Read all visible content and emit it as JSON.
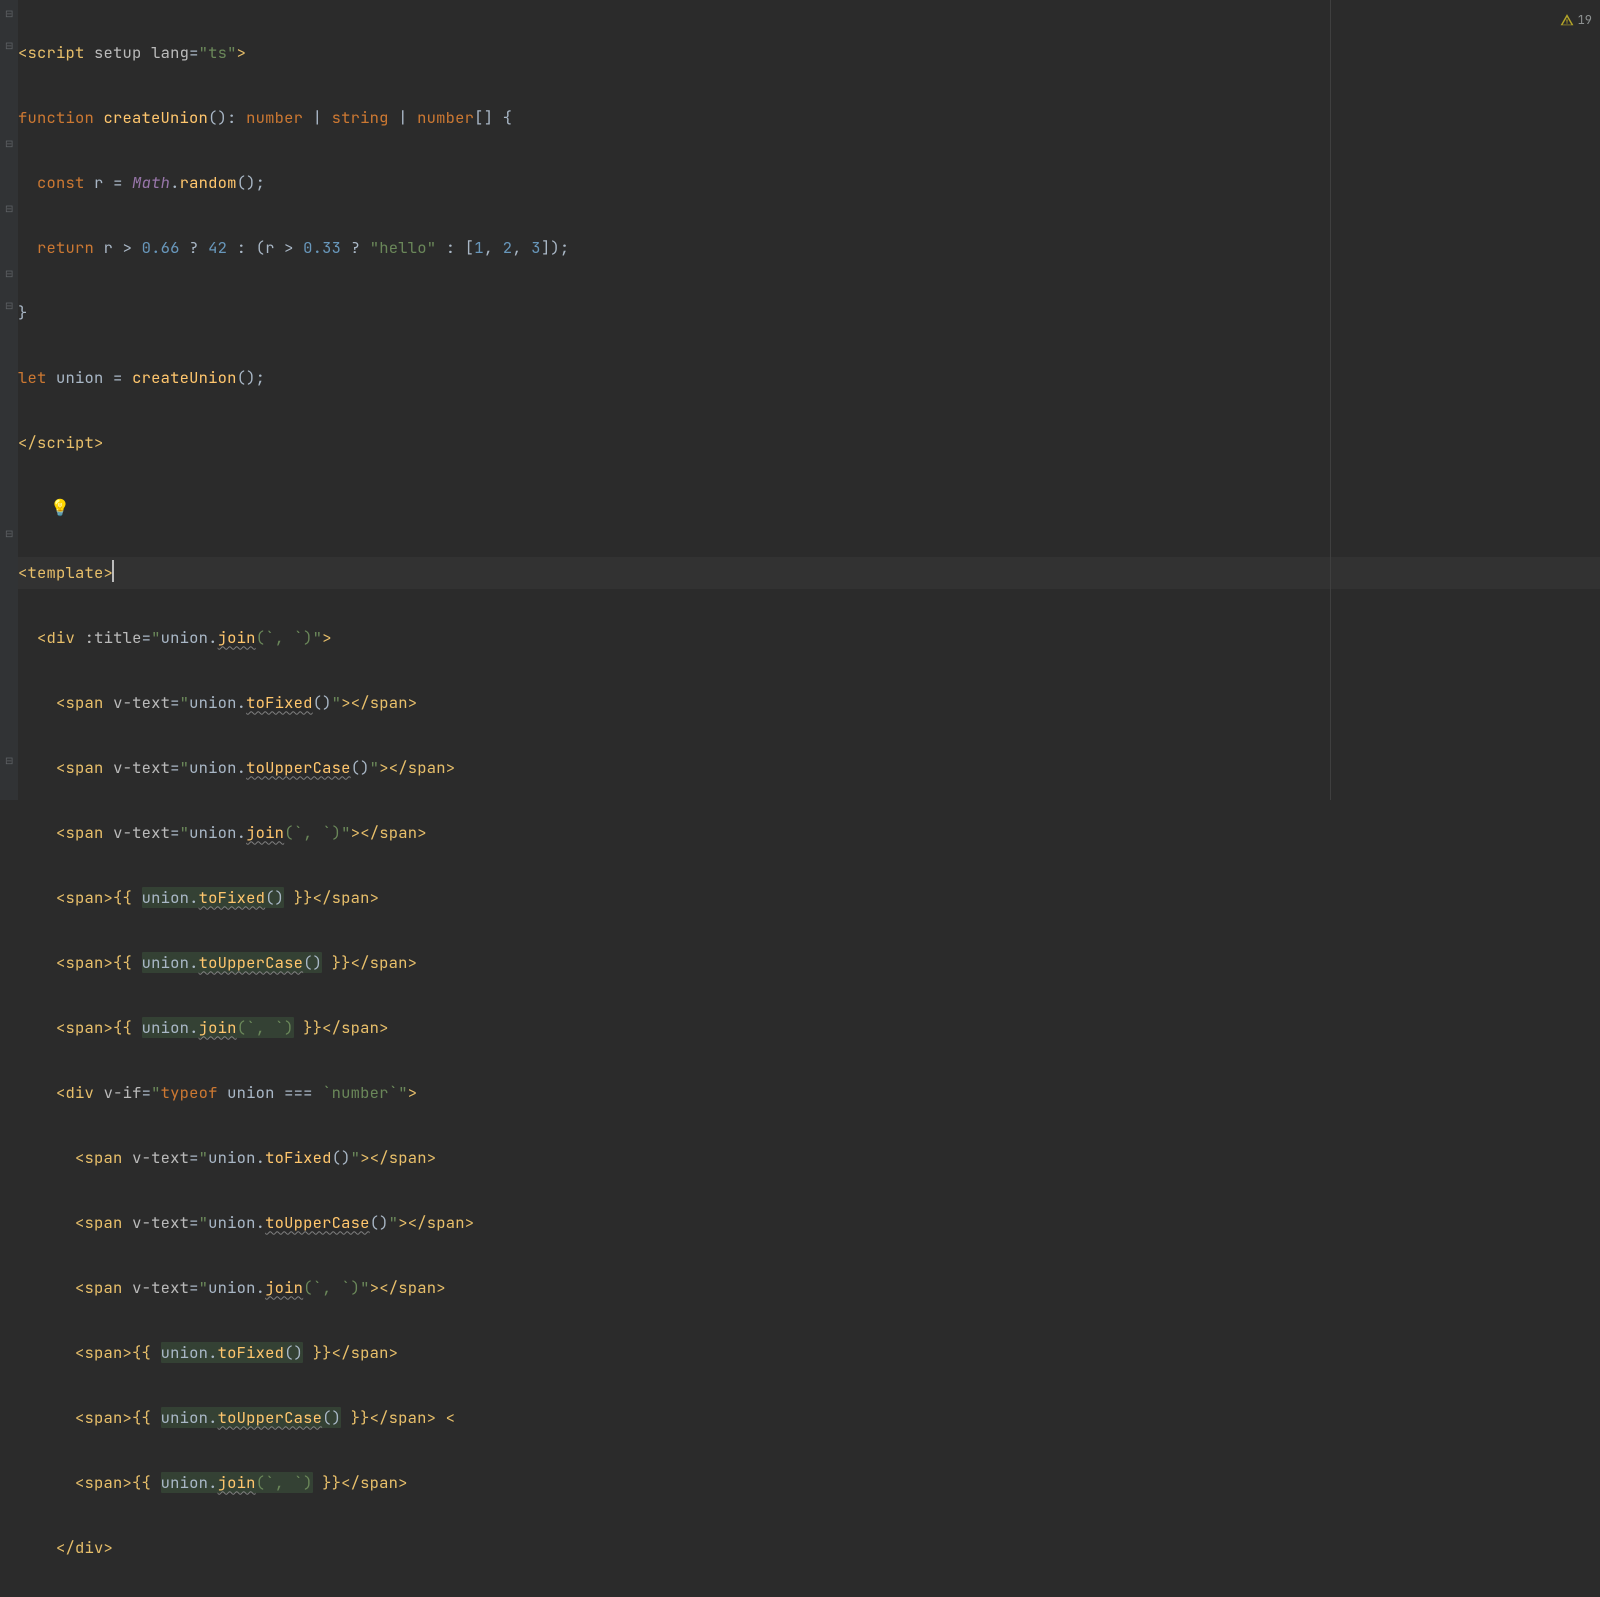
{
  "warnings_count": "19",
  "code": {
    "l1": {
      "pre": "<",
      "tag1": "script",
      "sp": " ",
      "a1": "setup",
      "sp2": " ",
      "a2": "lang",
      "eq": "=",
      "v": "\"ts\"",
      "post": ">"
    },
    "l2": {
      "kw1": "function",
      "sp": " ",
      "fn": "createUnion",
      "paren": "(): ",
      "t1": "number",
      "bar1": " | ",
      "t2": "string",
      "bar2": " | ",
      "t3": "number",
      "arr": "[] {"
    },
    "l3": {
      "indent": "  ",
      "kw": "const",
      "sp": " ",
      "id": "r",
      "eq": " = ",
      "cls": "Math",
      "dot": ".",
      "m": "random",
      "rest": "();"
    },
    "l4": {
      "indent": "  ",
      "kw": "return",
      "sp": " ",
      "id": "r",
      "op1": " > ",
      "n1": "0.66",
      "q": " ? ",
      "n2": "42",
      "c": " : (",
      "id2": "r",
      "op2": " > ",
      "n3": "0.33",
      "q2": " ? ",
      "s": "\"hello\"",
      "c2": " : [",
      "a1": "1",
      "cm1": ", ",
      "a2": "2",
      "cm2": ", ",
      "a3": "3",
      "end": "]);"
    },
    "l5": {
      "brace": "}"
    },
    "l6": {
      "kw": "let",
      "sp": " ",
      "id": "union",
      "eq": " = ",
      "fn": "createUnion",
      "rest": "();"
    },
    "l7": {
      "pre": "</",
      "tag": "script",
      "post": ">"
    },
    "l9": {
      "pre": "<",
      "tag": "template",
      "post": ">"
    },
    "l10": {
      "indent": "  ",
      "pre": "<",
      "tag": "div",
      "sp": " ",
      "attr": ":title",
      "eq": "=",
      "q": "\"",
      "id": "union",
      "dot": ".",
      "m": "join",
      "p": "(`, `)",
      "q2": "\"",
      "post": ">"
    },
    "l11": {
      "indent": "    ",
      "pre": "<",
      "tag": "span",
      "sp": " ",
      "attr": "v-text",
      "eq": "=",
      "q": "\"",
      "id": "union",
      "dot": ".",
      "m": "toFixed",
      "p": "()",
      "q2": "\"",
      "post": "></",
      "tag2": "span",
      "post2": ">"
    },
    "l12": {
      "indent": "    ",
      "pre": "<",
      "tag": "span",
      "sp": " ",
      "attr": "v-text",
      "eq": "=",
      "q": "\"",
      "id": "union",
      "dot": ".",
      "m": "toUpperCase",
      "p": "()",
      "q2": "\"",
      "post": "></",
      "tag2": "span",
      "post2": ">"
    },
    "l13": {
      "indent": "    ",
      "pre": "<",
      "tag": "span",
      "sp": " ",
      "attr": "v-text",
      "eq": "=",
      "q": "\"",
      "id": "union",
      "dot": ".",
      "m": "join",
      "p": "(`, `)",
      "q2": "\"",
      "post": "></",
      "tag2": "span",
      "post2": ">"
    },
    "l14": {
      "indent": "    ",
      "pre": "<",
      "tag": "span",
      "post": ">{{ ",
      "hl1": "union",
      "hl2": ".",
      "hl3": "toFixed",
      "hl4": "()",
      "post2": " }}</",
      "tag2": "span",
      "post3": ">"
    },
    "l15": {
      "indent": "    ",
      "pre": "<",
      "tag": "span",
      "post": ">{{ ",
      "hl1": "union",
      "hl2": ".",
      "hl3": "toUpperCase",
      "hl4": "()",
      "post2": " }}</",
      "tag2": "span",
      "post3": ">"
    },
    "l16": {
      "indent": "    ",
      "pre": "<",
      "tag": "span",
      "post": ">{{ ",
      "hl1": "union",
      "hl2": ".",
      "hl3": "join",
      "hl4": "(`, `)",
      "post2": " }}</",
      "tag2": "span",
      "post3": ">"
    },
    "l17": {
      "indent": "    ",
      "pre": "<",
      "tag": "div",
      "sp": " ",
      "attr": "v-if",
      "eq": "=",
      "q": "\"",
      "kw": "typeof",
      "sp2": " ",
      "id": "union",
      "op": " === ",
      "s": "`number`",
      "q2": "\"",
      "post": ">"
    },
    "l18": {
      "indent": "      ",
      "pre": "<",
      "tag": "span",
      "sp": " ",
      "attr": "v-text",
      "eq": "=",
      "q": "\"",
      "id": "union",
      "dot": ".",
      "m": "toFixed",
      "p": "()",
      "q2": "\"",
      "post": "></",
      "tag2": "span",
      "post2": ">"
    },
    "l19": {
      "indent": "      ",
      "pre": "<",
      "tag": "span",
      "sp": " ",
      "attr": "v-text",
      "eq": "=",
      "q": "\"",
      "id": "union",
      "dot": ".",
      "m": "toUpperCase",
      "p": "()",
      "q2": "\"",
      "post": "></",
      "tag2": "span",
      "post2": ">"
    },
    "l20": {
      "indent": "      ",
      "pre": "<",
      "tag": "span",
      "sp": " ",
      "attr": "v-text",
      "eq": "=",
      "q": "\"",
      "id": "union",
      "dot": ".",
      "m": "join",
      "p": "(`, `)",
      "q2": "\"",
      "post": "></",
      "tag2": "span",
      "post2": ">"
    },
    "l21": {
      "indent": "      ",
      "pre": "<",
      "tag": "span",
      "post": ">{{ ",
      "hl1": "union",
      "hl2": ".",
      "hl3": "toFixed",
      "hl4": "()",
      "post2": " }}</",
      "tag2": "span",
      "post3": ">"
    },
    "l22": {
      "indent": "      ",
      "pre": "<",
      "tag": "span",
      "post": ">{{ ",
      "hl1": "union",
      "hl2": ".",
      "hl3": "toUpperCase",
      "hl4": "()",
      "post2": " }}</",
      "tag2": "span",
      "post3": "> <"
    },
    "l23": {
      "indent": "      ",
      "pre": "<",
      "tag": "span",
      "post": ">{{ ",
      "hl1": "union",
      "hl2": ".",
      "hl3": "join",
      "hl4": "(`, `)",
      "post2": " }}</",
      "tag2": "span",
      "post3": ">"
    },
    "l24": {
      "indent": "    ",
      "pre": "</",
      "tag": "div",
      "post": ">"
    }
  }
}
